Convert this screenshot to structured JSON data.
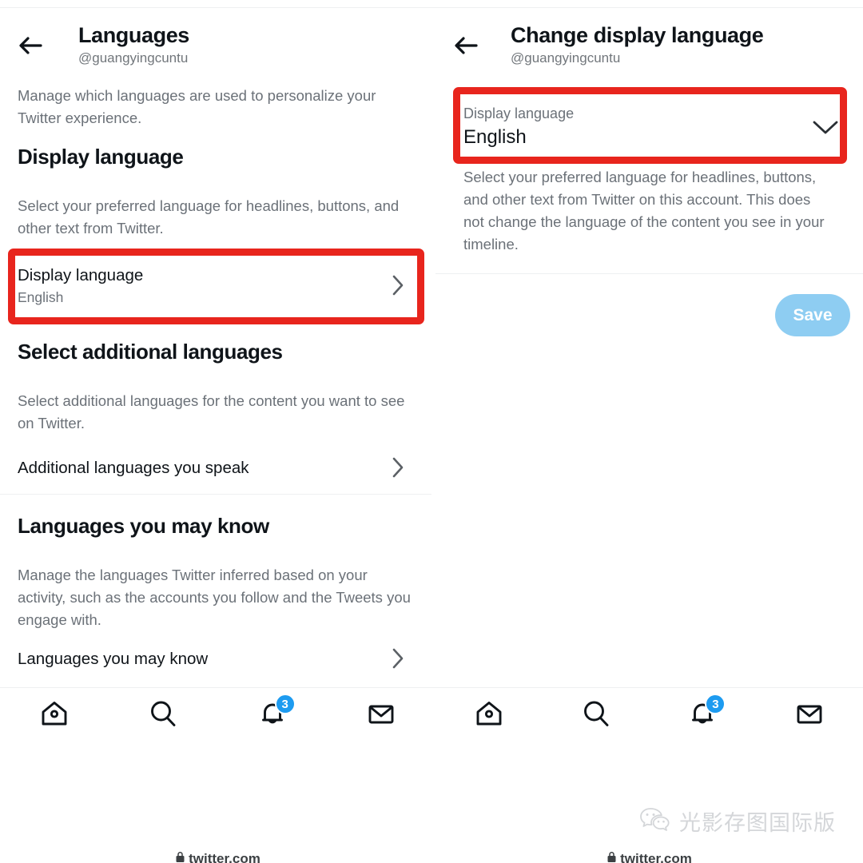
{
  "colors": {
    "highlight": "#e8251d",
    "accent": "#1d9bf0",
    "save_disabled": "#8ecdf2",
    "text_primary": "#0f1419",
    "text_secondary": "#6b7178",
    "divider": "#eef0f1"
  },
  "left_panel": {
    "back_icon": "back-arrow-icon",
    "title": "Languages",
    "handle": "@guangyingcuntu",
    "intro": "Manage which languages are used to personalize your Twitter experience.",
    "display_section": {
      "title": "Display language",
      "description": "Select your preferred language for headlines, buttons, and other text from Twitter.",
      "row": {
        "label": "Display language",
        "value": "English",
        "chevron_icon": "chevron-right-icon",
        "highlighted": true
      }
    },
    "additional_section": {
      "title": "Select additional languages",
      "description": "Select additional languages for the content you want to see on Twitter.",
      "row": {
        "label": "Additional languages you speak",
        "chevron_icon": "chevron-right-icon"
      }
    },
    "may_know_section": {
      "title": "Languages you may know",
      "description": "Manage the languages Twitter inferred based on your activity, such as the accounts you follow and the Tweets you engage with.",
      "row": {
        "label": "Languages you may know",
        "chevron_icon": "chevron-right-icon"
      }
    },
    "url": "twitter.com",
    "lock_icon": "lock-icon"
  },
  "right_panel": {
    "back_icon": "back-arrow-icon",
    "title": "Change display language",
    "handle": "@guangyingcuntu",
    "select_field": {
      "label": "Display language",
      "value": "English",
      "chevron_icon": "chevron-down-icon",
      "highlighted": true
    },
    "description": "Select your preferred language for headlines, buttons, and other text from Twitter on this account. This does not change the language of the content you see in your timeline.",
    "save_label": "Save",
    "url": "twitter.com",
    "lock_icon": "lock-icon"
  },
  "navbar": {
    "items": [
      {
        "icon": "home-icon",
        "badge": null
      },
      {
        "icon": "search-icon",
        "badge": null
      },
      {
        "icon": "notifications-bell-icon",
        "badge": "3"
      },
      {
        "icon": "messages-envelope-icon",
        "badge": null
      }
    ]
  },
  "watermark": {
    "icon": "wechat-icon",
    "text": "光影存图国际版"
  }
}
